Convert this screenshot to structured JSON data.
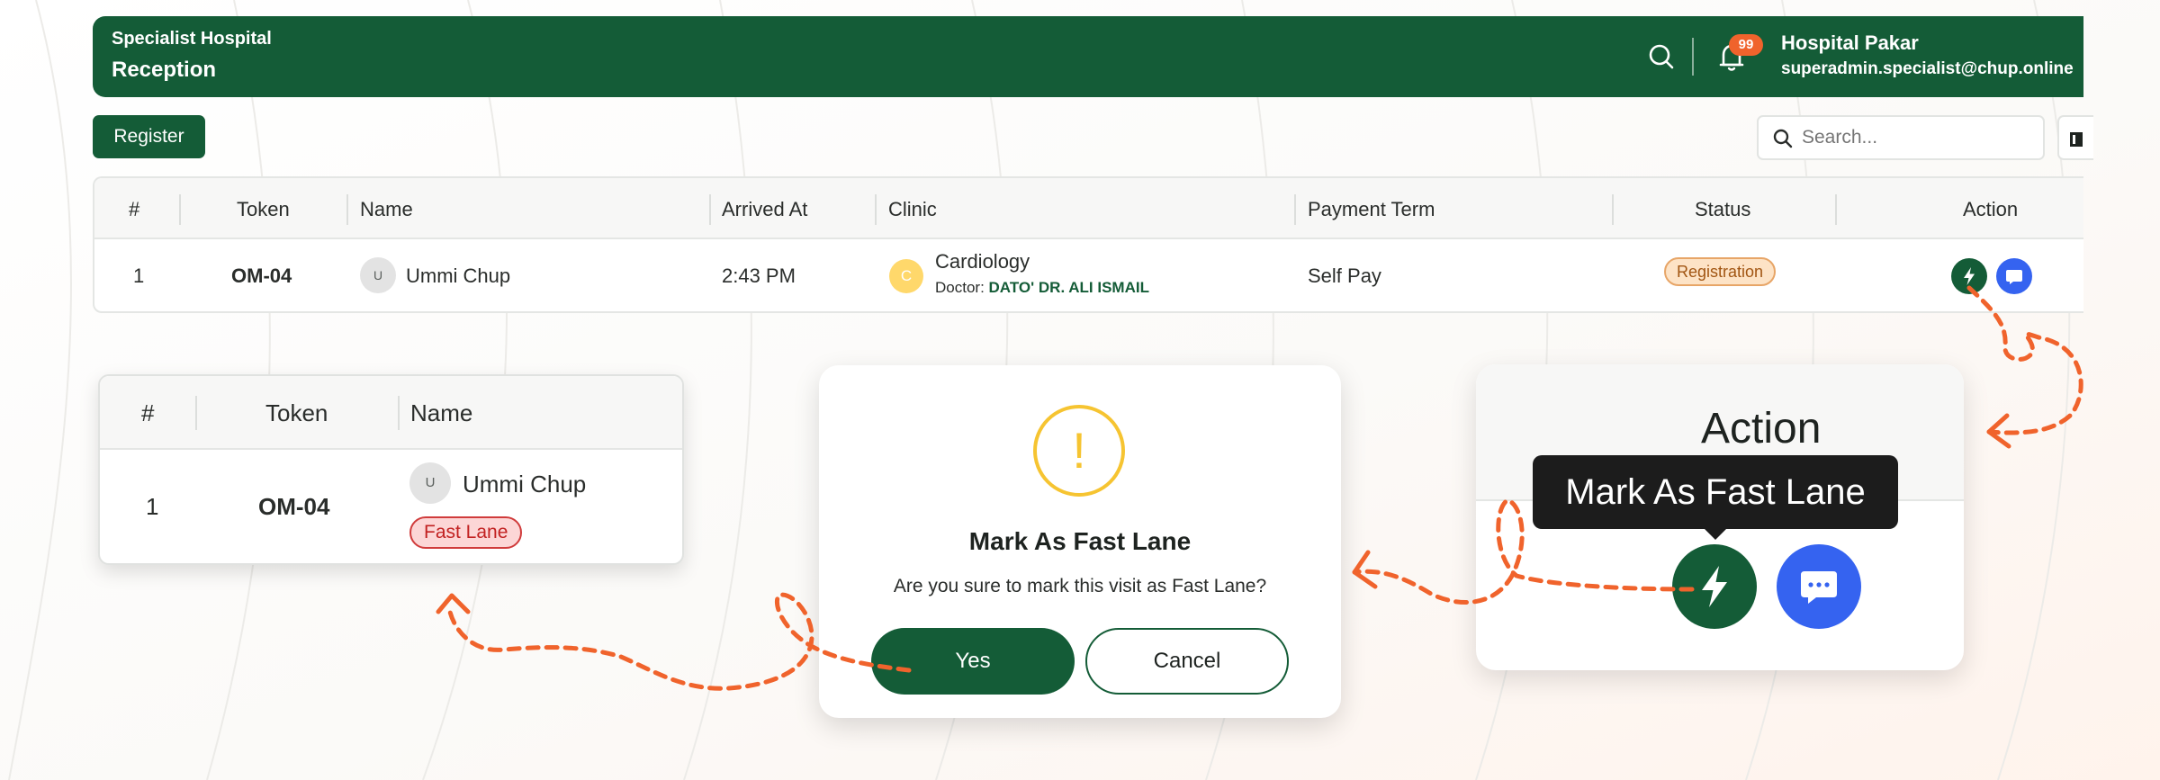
{
  "header": {
    "hospital_name": "Specialist Hospital",
    "page_title": "Reception",
    "notification_count": "99",
    "user_name": "Hospital Pakar",
    "user_email": "superadmin.specialist@chup.online"
  },
  "toolbar": {
    "register_label": "Register",
    "search_placeholder": "Search..."
  },
  "table": {
    "columns": [
      "#",
      "Token",
      "Name",
      "Arrived At",
      "Clinic",
      "Payment Term",
      "Status",
      "Action"
    ],
    "rows": [
      {
        "index": "1",
        "token": "OM-04",
        "avatar_initial": "U",
        "name": "Ummi Chup",
        "arrived_at": "2:43 PM",
        "clinic_initial": "C",
        "clinic": "Cardiology",
        "doctor_label": "Doctor:",
        "doctor": "DATO' DR. ALI ISMAIL",
        "payment_term": "Self Pay",
        "status": "Registration"
      }
    ]
  },
  "mini_table": {
    "columns": [
      "#",
      "Token",
      "Name"
    ],
    "row": {
      "index": "1",
      "token": "OM-04",
      "avatar_initial": "U",
      "name": "Ummi Chup",
      "badge": "Fast Lane"
    }
  },
  "dialog": {
    "icon": "!",
    "title": "Mark As Fast Lane",
    "message": "Are you sure to mark this visit as Fast Lane?",
    "confirm_label": "Yes",
    "cancel_label": "Cancel"
  },
  "action_zoom": {
    "header": "Action",
    "tooltip": "Mark As Fast Lane"
  },
  "colors": {
    "brand_green": "#145c37",
    "accent_blue": "#3563f0",
    "warning_yellow": "#f6c431",
    "arrow_orange": "#f0632c"
  },
  "icons": [
    "search-icon",
    "bell-icon",
    "columns-icon",
    "lightning-icon",
    "chat-icon",
    "warning-icon",
    "arrow-icon"
  ]
}
